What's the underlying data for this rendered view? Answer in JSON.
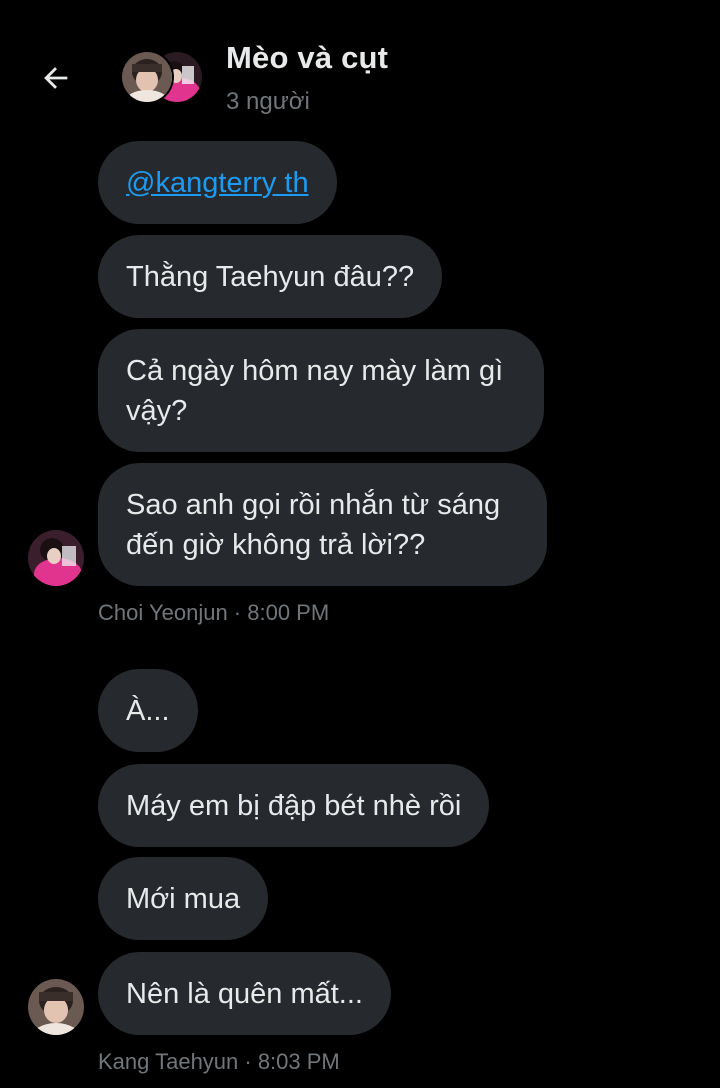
{
  "header": {
    "title": "Mèo và cụt",
    "subtitle": "3 người"
  },
  "messages": [
    {
      "text": "@kangterry th",
      "mention": true
    },
    {
      "text": "Thằng Taehyun đâu??"
    },
    {
      "text": "Cả ngày hôm nay mày làm gì vậy?"
    },
    {
      "text": "Sao anh gọi rồi nhắn từ sáng đến giờ không trả lời??"
    },
    {
      "text": "À..."
    },
    {
      "text": "Máy em bị đập bét nhè rồi"
    },
    {
      "text": "Mới mua"
    },
    {
      "text": "Nên là quên mất..."
    }
  ],
  "groups": [
    {
      "sender": "Choi Yeonjun",
      "time": "8:00 PM",
      "meta": "Choi Yeonjun · 8:00 PM"
    },
    {
      "sender": "Kang Taehyun",
      "time": "8:03 PM",
      "meta": "Kang Taehyun · 8:03 PM"
    }
  ],
  "colors": {
    "background": "#000000",
    "bubble": "#26292d",
    "text": "#e7e9ea",
    "muted": "#71767b",
    "link": "#1d9bf0"
  },
  "icons": {
    "back": "arrow-left-icon"
  }
}
